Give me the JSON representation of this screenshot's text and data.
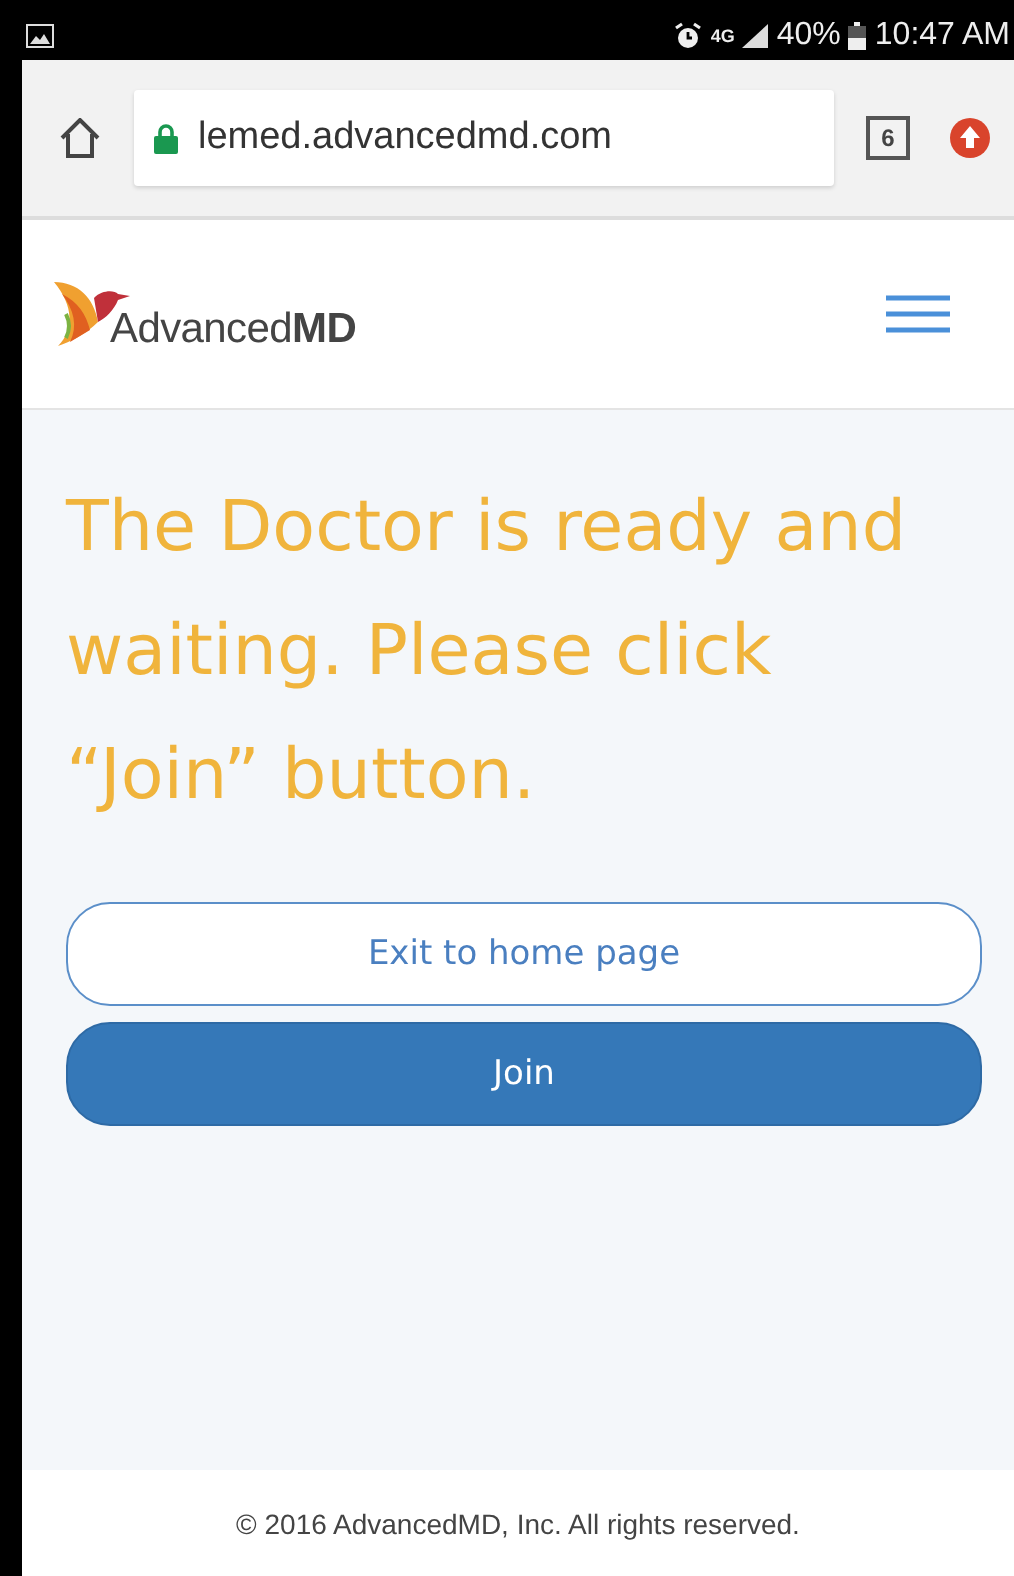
{
  "status_bar": {
    "signal_label": "4G",
    "battery": "40%",
    "time": "10:47 AM"
  },
  "browser": {
    "url": "lemed.advancedmd.com",
    "tab_count": "6"
  },
  "header": {
    "logo": "Advanced**MD**"
  },
  "message": "The Doctor is ready and waiting. Please click “Join” button.",
  "buttons": [
    {
      "label": "Exit to home page",
      "kind": "outline"
    },
    {
      "label": "Join",
      "kind": "primary"
    }
  ],
  "footer": "© 2016 AdvancedMD, Inc. All rights reserved."
}
